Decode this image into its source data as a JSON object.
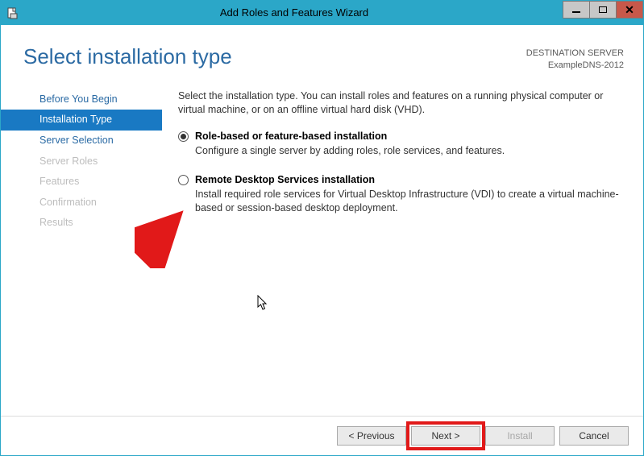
{
  "window": {
    "title": "Add Roles and Features Wizard"
  },
  "header": {
    "heading": "Select installation type",
    "dest_label": "DESTINATION SERVER",
    "dest_value": "ExampleDNS-2012"
  },
  "nav": {
    "items": [
      {
        "label": "Before You Begin",
        "state": "enabled"
      },
      {
        "label": "Installation Type",
        "state": "selected"
      },
      {
        "label": "Server Selection",
        "state": "enabled"
      },
      {
        "label": "Server Roles",
        "state": "disabled"
      },
      {
        "label": "Features",
        "state": "disabled"
      },
      {
        "label": "Confirmation",
        "state": "disabled"
      },
      {
        "label": "Results",
        "state": "disabled"
      }
    ]
  },
  "content": {
    "intro": "Select the installation type. You can install roles and features on a running physical computer or virtual machine, or on an offline virtual hard disk (VHD).",
    "options": [
      {
        "title": "Role-based or feature-based installation",
        "desc": "Configure a single server by adding roles, role services, and features.",
        "checked": true
      },
      {
        "title": "Remote Desktop Services installation",
        "desc": "Install required role services for Virtual Desktop Infrastructure (VDI) to create a virtual machine-based or session-based desktop deployment.",
        "checked": false
      }
    ]
  },
  "footer": {
    "previous": "< Previous",
    "next": "Next >",
    "install": "Install",
    "cancel": "Cancel"
  }
}
